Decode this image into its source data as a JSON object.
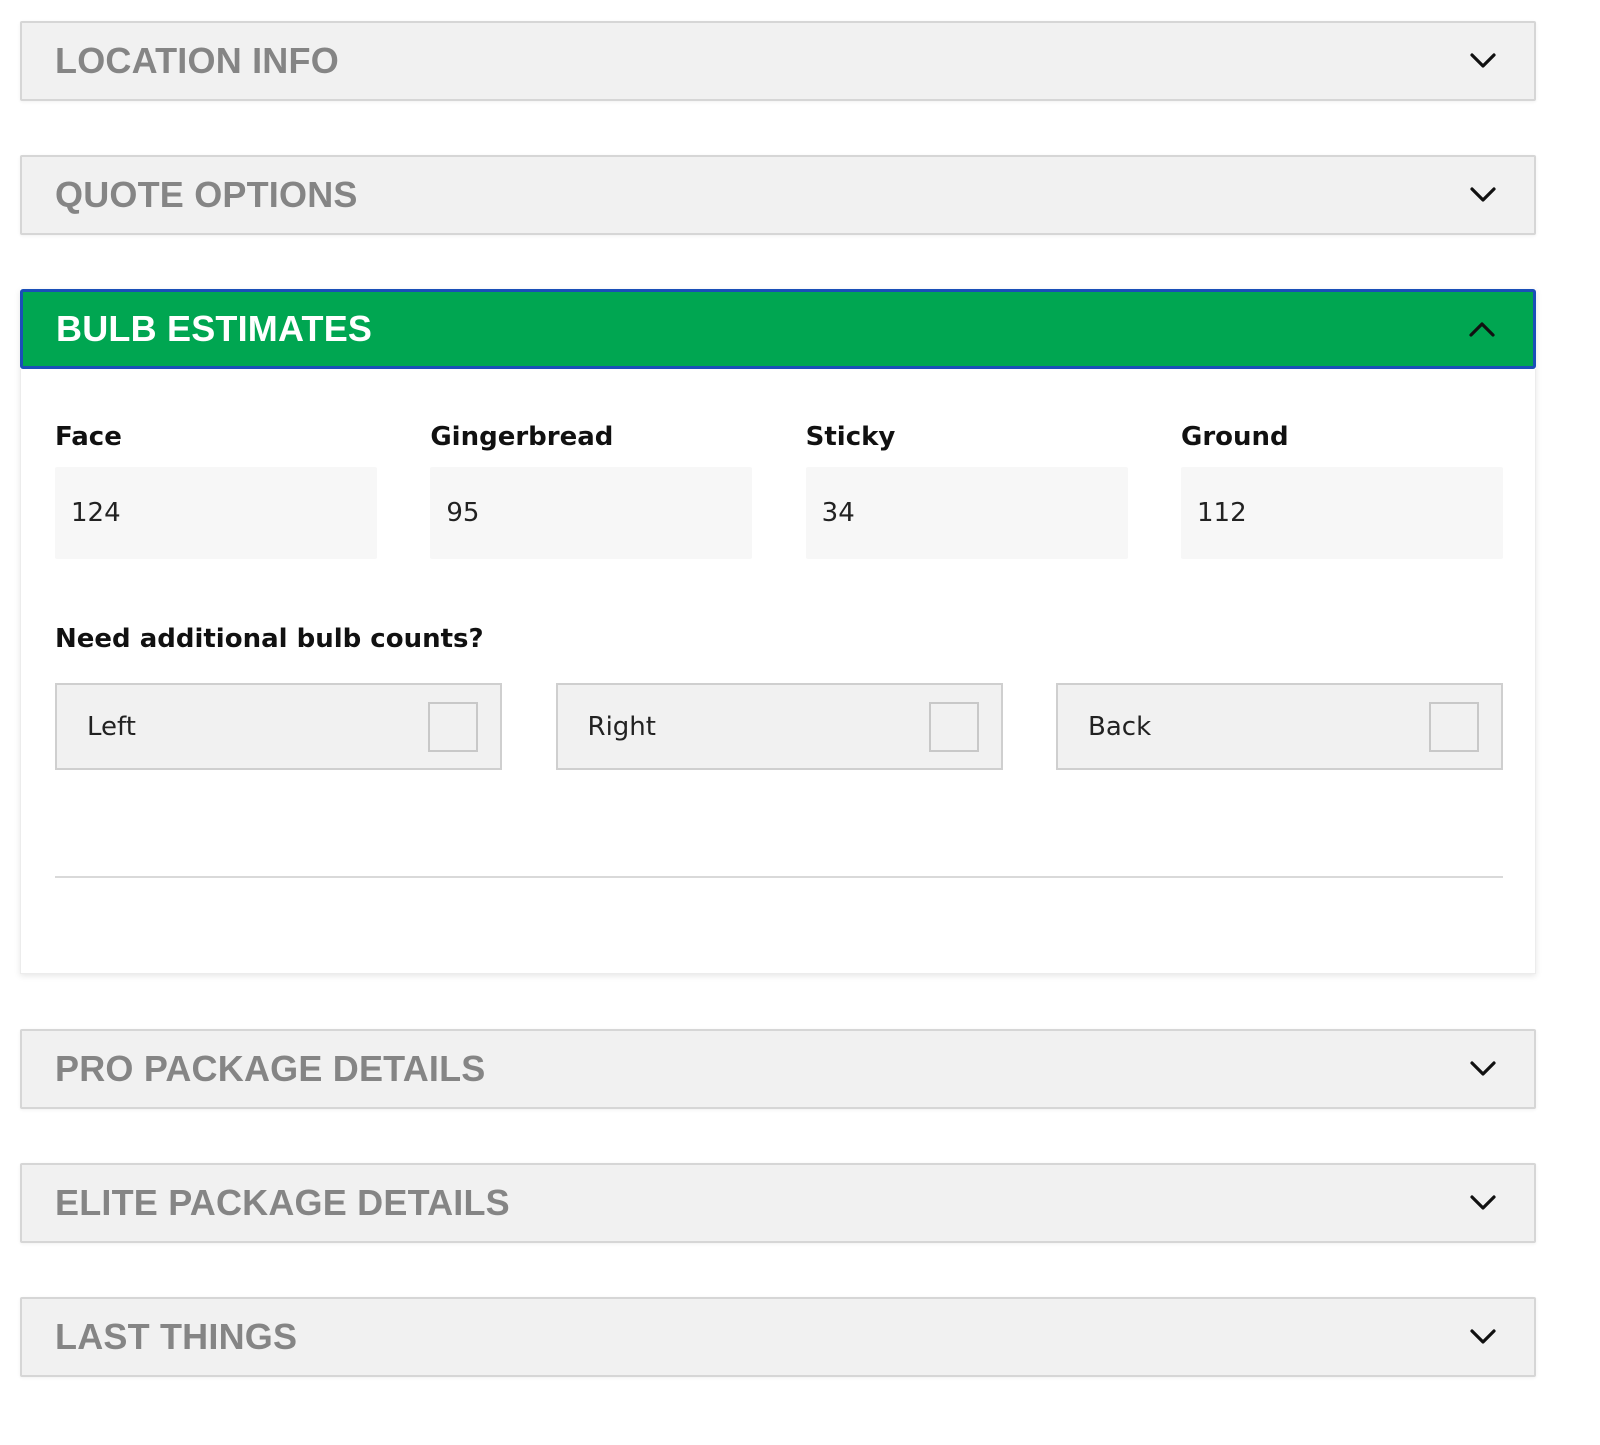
{
  "sections": [
    {
      "title": "LOCATION INFO",
      "expanded": false,
      "chevron_icon": "chevron-down-icon"
    },
    {
      "title": "QUOTE OPTIONS",
      "expanded": false,
      "chevron_icon": "chevron-down-icon"
    },
    {
      "title": "BULB ESTIMATES",
      "expanded": true,
      "chevron_icon": "chevron-up-icon"
    },
    {
      "title": "PRO PACKAGE DETAILS",
      "expanded": false,
      "chevron_icon": "chevron-down-icon"
    },
    {
      "title": "ELITE PACKAGE DETAILS",
      "expanded": false,
      "chevron_icon": "chevron-down-icon"
    },
    {
      "title": "LAST THINGS",
      "expanded": false,
      "chevron_icon": "chevron-down-icon"
    }
  ],
  "bulb_estimates": {
    "fields": [
      {
        "label": "Face",
        "value": "124"
      },
      {
        "label": "Gingerbread",
        "value": "95"
      },
      {
        "label": "Sticky",
        "value": "34"
      },
      {
        "label": "Ground",
        "value": "112"
      }
    ],
    "additional_question": "Need additional bulb counts?",
    "additional_options": [
      {
        "label": "Left",
        "checked": false
      },
      {
        "label": "Right",
        "checked": false
      },
      {
        "label": "Back",
        "checked": false
      }
    ]
  },
  "colors": {
    "active_header_bg": "#00a651",
    "active_header_border": "#1a4fb8",
    "collapsed_header_bg": "#f1f1f1",
    "collapsed_title": "#858585"
  }
}
